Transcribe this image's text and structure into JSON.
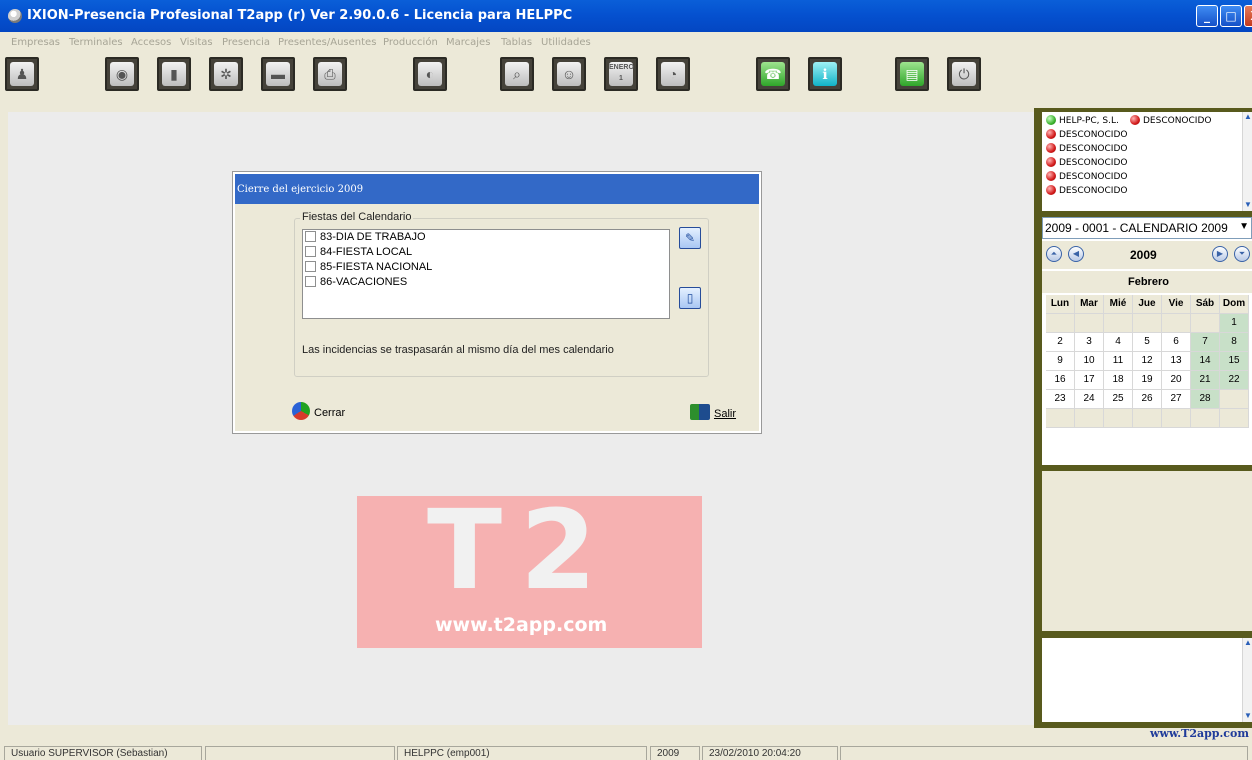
{
  "window": {
    "title": "IXION-Presencia Profesional T2app (r) Ver 2.90.0.6  -  Licencia para HELPPC",
    "minimize_label": "_",
    "maximize_label": "□",
    "close_label": "X"
  },
  "menu": [
    "Empresas",
    "Terminales",
    "Accesos",
    "Visitas",
    "Presencia",
    "Presentes/Ausentes",
    "Producción",
    "Marcajes",
    "Tablas",
    "Utilidades"
  ],
  "toolbar": {
    "calendar_button_text": "ENERO 1",
    "buttons": [
      "users",
      "disc",
      "badge",
      "gear",
      "card",
      "printer",
      "compass",
      "doc-search",
      "person",
      "calendar",
      "gauge",
      "phone",
      "info",
      "sheet",
      "power"
    ]
  },
  "background_logo": {
    "big_text": "T2",
    "url": "www.t2app.com"
  },
  "dialog": {
    "title": "Cierre del ejercicio 2009",
    "group_label": "Fiestas del Calendario",
    "items": [
      {
        "label": "83-DIA DE TRABAJO",
        "checked": false
      },
      {
        "label": "84-FIESTA LOCAL",
        "checked": false
      },
      {
        "label": "85-FIESTA NACIONAL",
        "checked": false
      },
      {
        "label": "86-VACACIONES",
        "checked": false
      }
    ],
    "info_text": "Las incidencias se traspasarán al mismo día del mes calendario",
    "close_button": "Cerrar",
    "exit_button": "Salir"
  },
  "side": {
    "companies": [
      {
        "name": "HELP-PC, S.L.",
        "status": "green"
      },
      {
        "name": "DESCONOCIDO",
        "status": "red"
      },
      {
        "name": "DESCONOCIDO",
        "status": "red"
      },
      {
        "name": "DESCONOCIDO",
        "status": "red"
      },
      {
        "name": "DESCONOCIDO",
        "status": "red"
      },
      {
        "name": "DESCONOCIDO",
        "status": "red"
      },
      {
        "name": "DESCONOCIDO",
        "status": "red"
      }
    ],
    "calendar_select": "2009 - 0001 - CALENDARIO 2009",
    "year": "2009",
    "month": "Febrero",
    "weekdays": [
      "Lun",
      "Mar",
      "Mié",
      "Jue",
      "Vie",
      "Sáb",
      "Dom"
    ],
    "weeks": [
      [
        "",
        "",
        "",
        "",
        "",
        "",
        "1"
      ],
      [
        "2",
        "3",
        "4",
        "5",
        "6",
        "7",
        "8"
      ],
      [
        "9",
        "10",
        "11",
        "12",
        "13",
        "14",
        "15"
      ],
      [
        "16",
        "17",
        "18",
        "19",
        "20",
        "21",
        "22"
      ],
      [
        "23",
        "24",
        "25",
        "26",
        "27",
        "28",
        ""
      ],
      [
        "",
        "",
        "",
        "",
        "",
        "",
        ""
      ]
    ],
    "site_link": "www.T2app.com"
  },
  "status": {
    "user": "Usuario SUPERVISOR (Sebastian)",
    "empty1": "",
    "company": "HELPPC  (emp001)",
    "year": "2009",
    "datetime": "23/02/2010  20:04:20",
    "empty2": ""
  },
  "colors": {
    "titlebar": "#0551d0",
    "dialog_title": "#3369c7",
    "right_panel_border": "#585a1d",
    "weekend_cell": "#c8e0c8"
  }
}
